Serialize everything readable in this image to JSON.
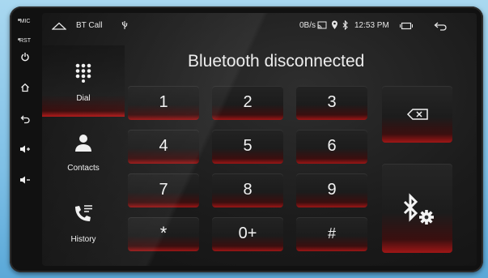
{
  "bezel": {
    "mic_label": "MIC",
    "rst_label": "RST"
  },
  "status_bar": {
    "app_label": "BT Call",
    "net_speed": "0B/s",
    "time": "12:53 PM"
  },
  "page": {
    "title": "Bluetooth disconnected"
  },
  "sidebar": {
    "items": [
      {
        "label": "Dial",
        "icon": "dialpad-icon"
      },
      {
        "label": "Contacts",
        "icon": "person-icon"
      },
      {
        "label": "History",
        "icon": "call-history-icon"
      }
    ]
  },
  "keypad": {
    "keys": [
      "1",
      "2",
      "3",
      "4",
      "5",
      "6",
      "7",
      "8",
      "9",
      "*",
      "0+",
      "#"
    ]
  },
  "actions": {
    "backspace_icon": "backspace-icon",
    "bt_settings_icon": "bluetooth-settings-icon"
  },
  "colors": {
    "accent": "#b21818"
  }
}
